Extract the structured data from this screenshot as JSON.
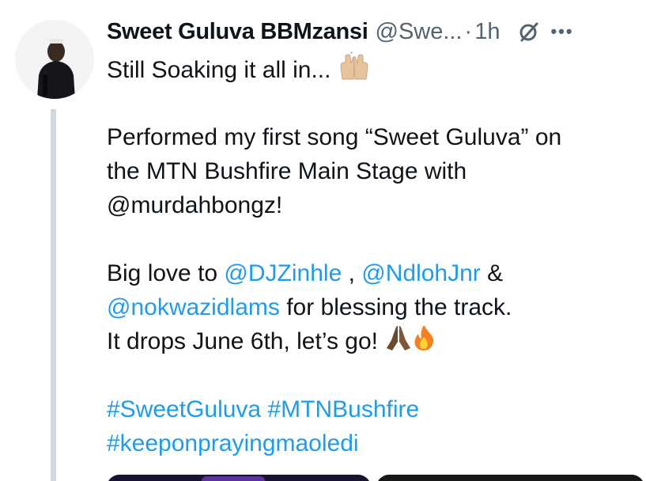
{
  "tweet": {
    "display_name": "Sweet Guluva BBMzansi",
    "handle": "@Swe...",
    "separator": "·",
    "time": "1h",
    "icons": {
      "grok": "grok-icon",
      "more": "more-options-icon",
      "raised_hands": "raised-hands-emoji",
      "pray": "folded-hands-emoji",
      "fire": "fire-emoji"
    },
    "body": {
      "line1": "Still Soaking it all in...",
      "line2": "Performed my first song “Sweet Guluva” on",
      "line3": "the MTN Bushfire Main Stage with",
      "line4": "@murdahbongz!",
      "line5_prefix": "Big love to ",
      "mention_djzinhle": "@DJZinhle",
      "line5_sep": " , ",
      "mention_ndlohjnr": "@NdlohJnr",
      "line5_suffix": " &",
      "mention_nokwazidlams": "@nokwazidlams",
      "line6_suffix": " for blessing the track.",
      "line7": "It drops June 6th, let’s go! ",
      "hashtag_sweetguluva": "#SweetGuluva",
      "hashtag_mtnbushfire": "#MTNBushfire",
      "hashtag_keeponpraying": "#keeponprayingmaoledi"
    }
  },
  "colors": {
    "text": "#0f1419",
    "secondary": "#536471",
    "link": "#1d9bf0",
    "thread_line": "#cfd9de"
  }
}
